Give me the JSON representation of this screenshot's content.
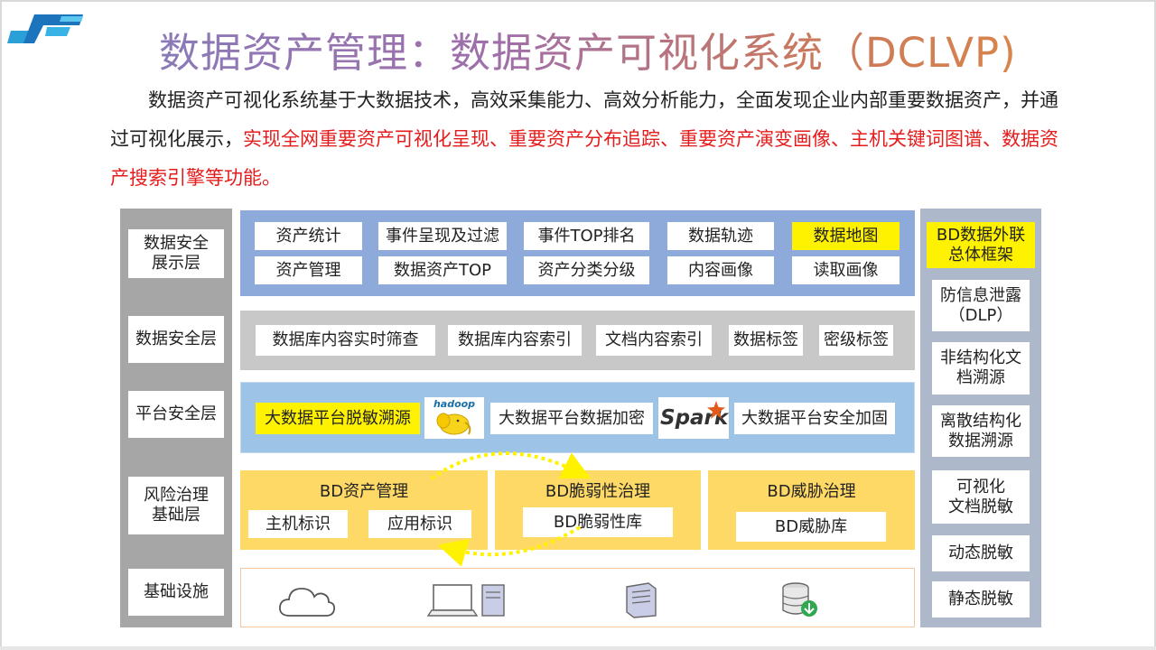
{
  "slide": {
    "title": "数据资产管理：数据资产可视化系统（DCLVP)",
    "intro_normal": "数据资产可视化系统基于大数据技术，高效采集能力、高效分析能力，全面发现企业内部重要数据资产，并通过可视化展示，",
    "intro_highlight": "实现全网重要资产可视化呈现、重要资产分布追踪、重要资产演变画像、主机关键词图谱、数据资产搜索引擎等功能。",
    "highlight_color": "#e51c1c"
  },
  "layers": {
    "display": "数据安全\n展示层",
    "data": "数据安全层",
    "platform": "平台安全层",
    "risk": "风险治理\n基础层",
    "infra": "基础设施"
  },
  "display_items": {
    "row1": [
      "资产统计",
      "事件呈现及过滤",
      "事件TOP排名",
      "数据轨迹",
      "数据地图"
    ],
    "row2": [
      "资产管理",
      "数据资产TOP",
      "资产分类分级",
      "内容画像",
      "读取画像"
    ]
  },
  "data_items": [
    "数据库内容实时筛查",
    "数据库内容索引",
    "文档内容索引",
    "数据标签",
    "密级标签"
  ],
  "platform_items": {
    "desensitize": "大数据平台脱敏溯源",
    "hadoop_logo": "hadoop",
    "encrypt": "大数据平台数据加密",
    "spark_logo": "Spark",
    "harden": "大数据平台安全加固"
  },
  "risk": {
    "asset": {
      "title": "BD资产管理",
      "items": [
        "主机标识",
        "应用标识"
      ]
    },
    "vuln": {
      "title": "BD脆弱性治理",
      "items": [
        "BD脆弱性库"
      ]
    },
    "threat": {
      "title": "BD威胁治理",
      "items": [
        "BD威胁库"
      ]
    }
  },
  "infra_icons": [
    "cloud-icon",
    "laptop-server-icon",
    "server-icon",
    "database-icon"
  ],
  "right_items": [
    "BD数据外联\n总体框架",
    "防信息泄露\n（DLP）",
    "非结构化文\n档溯源",
    "离散结构化\n数据溯源",
    "可视化\n文档脱敏",
    "动态脱敏",
    "静态脱敏"
  ],
  "colors": {
    "left_column": "#a6a6a6",
    "right_column": "#adb9ca",
    "display_band": "#8eaadb",
    "data_band": "#c8c8c8",
    "platform_band": "#9dc3e6",
    "risk_box": "#ffd966",
    "highlight_cell": "#fff200"
  }
}
